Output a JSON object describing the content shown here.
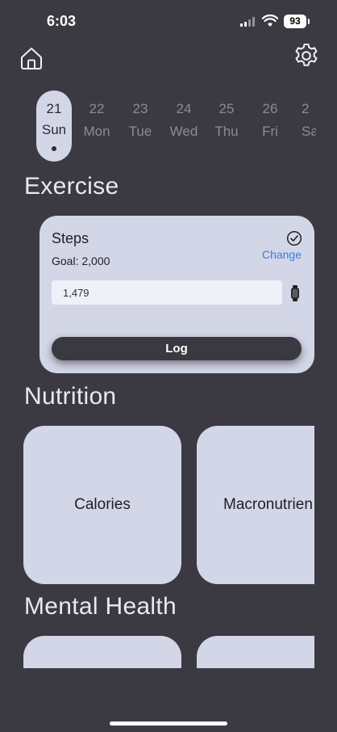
{
  "status": {
    "time": "6:03",
    "battery": "93"
  },
  "days": [
    {
      "num": "21",
      "dow": "Sun",
      "selected": true
    },
    {
      "num": "22",
      "dow": "Mon"
    },
    {
      "num": "23",
      "dow": "Tue"
    },
    {
      "num": "24",
      "dow": "Wed"
    },
    {
      "num": "25",
      "dow": "Thu"
    },
    {
      "num": "26",
      "dow": "Fri"
    },
    {
      "num": "2",
      "dow": "Sa"
    }
  ],
  "exercise": {
    "title": "Exercise",
    "card": {
      "title": "Steps",
      "goal": "Goal: 2,000",
      "change_label": "Change",
      "value": "1,479",
      "log_label": "Log"
    }
  },
  "nutrition": {
    "title": "Nutrition",
    "tiles": [
      "Calories",
      "Macronutrien"
    ]
  },
  "mental_health": {
    "title": "Mental Health"
  },
  "colors": {
    "accent": "#3f7be0",
    "background": "#3b3a42",
    "card": "#d3d6e6"
  }
}
